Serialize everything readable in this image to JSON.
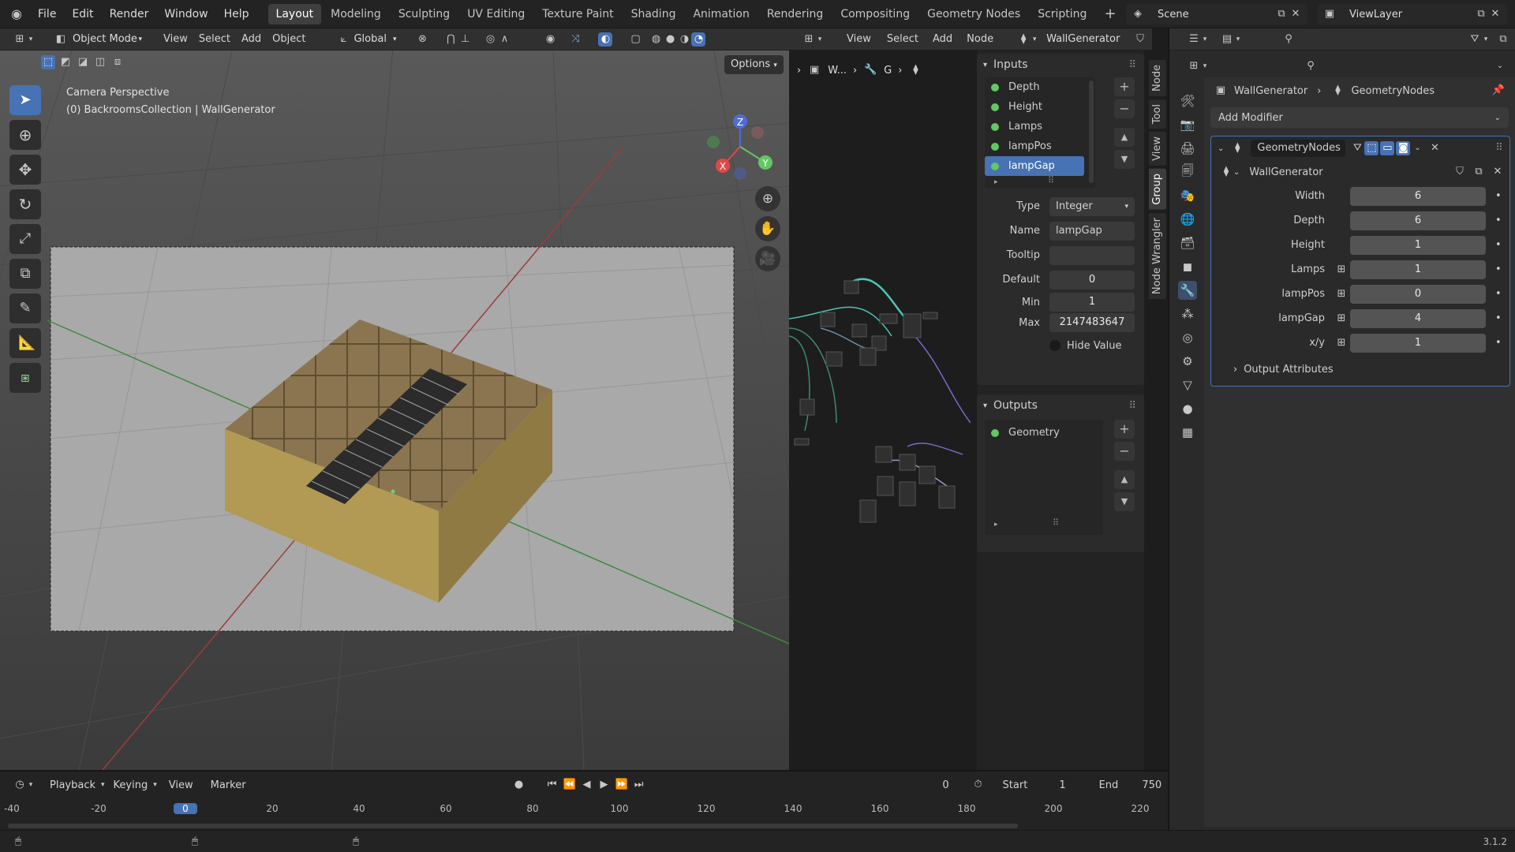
{
  "topbar": {
    "menus": [
      "File",
      "Edit",
      "Render",
      "Window",
      "Help"
    ],
    "workspaces": [
      "Layout",
      "Modeling",
      "Sculpting",
      "UV Editing",
      "Texture Paint",
      "Shading",
      "Animation",
      "Rendering",
      "Compositing",
      "Geometry Nodes",
      "Scripting"
    ],
    "active_workspace": "Layout",
    "add_workspace": "+",
    "scene_name": "Scene",
    "view_layer": "ViewLayer"
  },
  "viewport": {
    "mode": "Object Mode",
    "menus": [
      "View",
      "Select",
      "Add",
      "Object"
    ],
    "orientation": "Global",
    "options_label": "Options",
    "info_line1": "Camera Perspective",
    "info_line2": "(0) BackroomsCollection | WallGenerator",
    "gizmo_x": "X",
    "gizmo_y": "Y",
    "gizmo_z": "Z"
  },
  "node_editor": {
    "menus": [
      "View",
      "Select",
      "Add",
      "Node"
    ],
    "tree_name": "WallGenerator",
    "breadcrumb_1": "W...",
    "breadcrumb_2": "G",
    "inputs_title": "Inputs",
    "inputs": [
      "Depth",
      "Height",
      "Lamps",
      "lampPos",
      "lampGap"
    ],
    "selected_input": "lampGap",
    "props": {
      "type_label": "Type",
      "type_value": "Integer",
      "name_label": "Name",
      "name_value": "lampGap",
      "tooltip_label": "Tooltip",
      "tooltip_value": "",
      "default_label": "Default",
      "default_value": "0",
      "min_label": "Min",
      "min_value": "1",
      "max_label": "Max",
      "max_value": "2147483647",
      "hide_value_label": "Hide Value"
    },
    "outputs_title": "Outputs",
    "outputs": [
      "Geometry"
    ],
    "side_tabs": [
      "Node",
      "Tool",
      "View",
      "Group",
      "Node Wrangler"
    ],
    "active_side_tab": "Group"
  },
  "properties": {
    "breadcrumb_object": "WallGenerator",
    "breadcrumb_modifier": "GeometryNodes",
    "add_modifier_label": "Add Modifier",
    "modifier_name": "GeometryNodes",
    "node_group": "WallGenerator",
    "params": [
      {
        "label": "Width",
        "value": "6",
        "has_icon": false
      },
      {
        "label": "Depth",
        "value": "6",
        "has_icon": false
      },
      {
        "label": "Height",
        "value": "1",
        "has_icon": false
      },
      {
        "label": "Lamps",
        "value": "1",
        "has_icon": true
      },
      {
        "label": "lampPos",
        "value": "0",
        "has_icon": true
      },
      {
        "label": "lampGap",
        "value": "4",
        "has_icon": true
      },
      {
        "label": "x/y",
        "value": "1",
        "has_icon": true
      }
    ],
    "output_attributes_label": "Output Attributes"
  },
  "timeline": {
    "menus": [
      "Playback",
      "Keying",
      "View",
      "Marker"
    ],
    "current_frame": "0",
    "start_label": "Start",
    "start_value": "1",
    "end_label": "End",
    "end_value": "750",
    "ruler": [
      "-40",
      "-20",
      "0",
      "20",
      "40",
      "60",
      "80",
      "100",
      "120",
      "140",
      "160",
      "180",
      "200",
      "220"
    ],
    "playhead": "0"
  },
  "statusbar": {
    "version": "3.1.2"
  },
  "colors": {
    "accent": "#4772b3",
    "socket_green": "#63c763",
    "axis_x": "#e04848",
    "axis_y": "#63c763",
    "axis_z": "#4f6cd6"
  }
}
